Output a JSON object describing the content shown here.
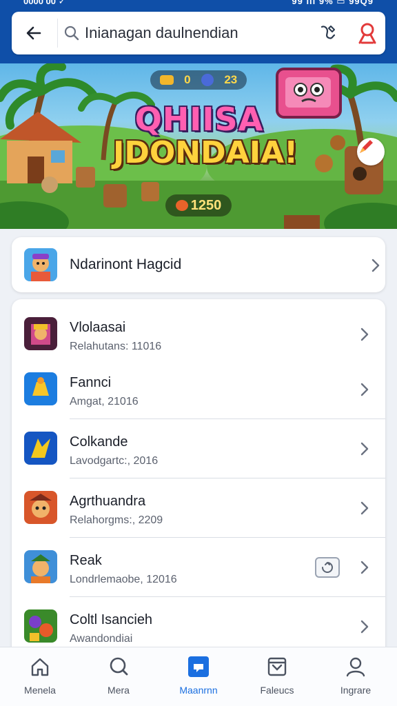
{
  "status": {
    "left": "0000 00 ✓",
    "right": "99 ııl 9% ▭ 99Q9"
  },
  "search": {
    "query": "Inianagan daulnendian"
  },
  "banner": {
    "hud_left": "0",
    "hud_right": "23",
    "title_line1": "QHIISA",
    "title_line2": "JDONDAIA!",
    "score": "1250"
  },
  "featured": {
    "title": "Ndarinont Hagcid"
  },
  "list": [
    {
      "title": "Vlolaasai",
      "subtitle": "Relahutans: 11016"
    },
    {
      "title": "Fannci",
      "subtitle": "Amgat, 21016"
    },
    {
      "title": "Colkande",
      "subtitle": "Lavodgartc:, 2016"
    },
    {
      "title": "Agrthuandra",
      "subtitle": "Relahorgms:, 2209"
    },
    {
      "title": "Reak",
      "subtitle": "Londrlemaobe, 12016"
    },
    {
      "title": "Coltl Isancieh",
      "subtitle": "Awandondiai"
    }
  ],
  "nav": [
    {
      "label": "Menela",
      "icon": "home-icon"
    },
    {
      "label": "Mera",
      "icon": "search-icon"
    },
    {
      "label": "Maanrnn",
      "icon": "library-icon",
      "active": true
    },
    {
      "label": "Faleucs",
      "icon": "inbox-icon"
    },
    {
      "label": "Ingrare",
      "icon": "profile-icon"
    }
  ],
  "colors": {
    "header": "#0f4fa8",
    "accent": "#1b6fe0",
    "mic": "#2b3a4e",
    "profile": "#e23a3a"
  }
}
